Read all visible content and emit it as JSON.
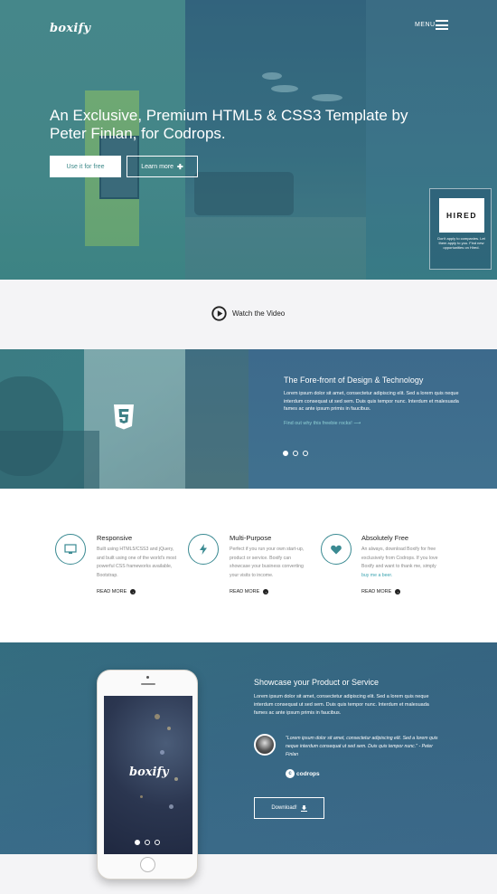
{
  "header": {
    "logo": "boxify",
    "menu_label": "MENU",
    "menu_icon": "hamburger-icon"
  },
  "hero": {
    "title": "An Exclusive, Premium HTML5 & CSS3 Template by Peter Finlan, for Codrops.",
    "primary_button": "Use it for free",
    "secondary_button": "Learn more",
    "secondary_button_icon": "plus-icon",
    "ad": {
      "logo": "HIRED",
      "text": "Don't apply to companies. Let them apply to you. Find new opportunities on Hired."
    }
  },
  "video": {
    "label": "Watch the Video",
    "icon": "play-icon"
  },
  "band": {
    "icon": "html5-icon",
    "title": "The Fore-front of Design & Technology",
    "body": "Lorem ipsum dolor sit amet, consectetur adipiscing elit. Sed a lorem quis neque interdum consequat ut sed sem. Duis quis tempor nunc. Interdum et malesuada fames ac ante ipsum primis in faucibus.",
    "link": "Find out why this freebie rocks! ⟶",
    "slider_dots": 3,
    "active_dot": 0
  },
  "features": [
    {
      "icon": "monitor-icon",
      "title": "Responsive",
      "body": "Built using HTML5/CSS3 and jQuery, and built using one of the world's most powerful CSS frameworks available, Bootstrap.",
      "more": "READ MORE"
    },
    {
      "icon": "lightning-icon",
      "title": "Multi-Purpose",
      "body": "Perfect if you run your own start-up, product or service. Boxify can showcase your business converting your visits to income.",
      "more": "READ MORE"
    },
    {
      "icon": "heart-icon",
      "title": "Absolutely Free",
      "body_prefix": "An always, download Boxify for free exclusively from Codrops. If you love Boxify and want to thank me, simply ",
      "body_link": "buy me a beer.",
      "more": "READ MORE"
    }
  ],
  "showcase": {
    "phone_logo": "boxify",
    "title": "Showcase your Product or Service",
    "body": "Lorem ipsum dolor sit amet, consectetur adipiscing elit. Sed a lorem quis neque interdum consequat ut sed sem. Duis quis tempor nunc. Interdum et malesuada fames ac ante ipsum primis in faucibus.",
    "quote": "\"Lorem ipsum dolor sit amet, consectetur adipiscing elit. Sed a lorem quis neque interdum consequat ut sed sem. Duis quis tempor nunc.\" - Peter Finlan",
    "brand": "codrops",
    "download_button": "Download!",
    "download_icon": "download-icon",
    "slider_dots": 3,
    "active_dot": 0
  },
  "colors": {
    "accent": "#3a8a92",
    "band_blue": "#3d6a8c",
    "link": "#3aa3b0"
  }
}
